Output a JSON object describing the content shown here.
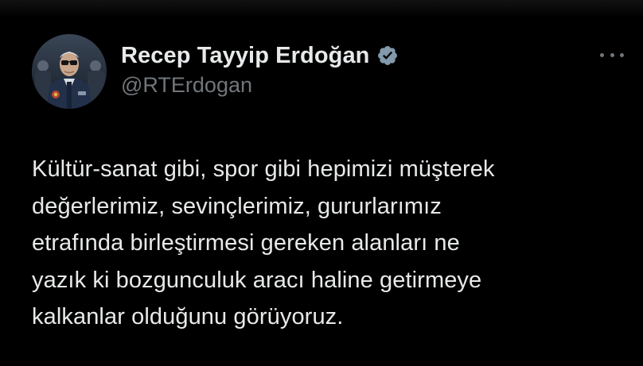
{
  "tweet": {
    "author": {
      "display_name": "Recep Tayyip Erdoğan",
      "handle": "@RTErdogan",
      "verified": true,
      "verified_badge_icon": "verified-badge-icon",
      "verified_badge_color": "#829aab",
      "avatar_icon": "profile-photo"
    },
    "more_icon": "more-options-icon",
    "text_lines": [
      "Kültür-sanat gibi, spor gibi hepimizi müşterek",
      "değerlerimiz, sevinçlerimiz, gururlarımız",
      "etrafında birleştirmesi gereken alanları ne",
      "yazık ki bozgunculuk aracı haline getirmeye",
      "kalkanlar olduğunu görüyoruz."
    ]
  },
  "colors": {
    "background": "#000000",
    "primary_text": "#e7e9ea",
    "secondary_text": "#71767b"
  }
}
